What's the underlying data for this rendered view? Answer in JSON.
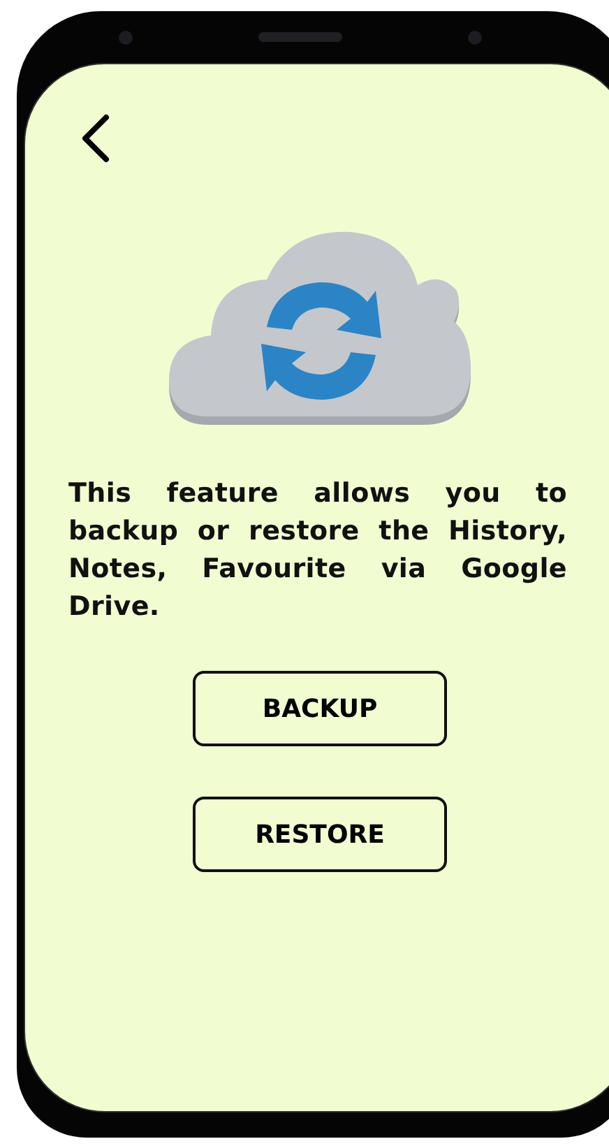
{
  "screen": {
    "description": "This feature allows you to backup or restore the History, Notes, Favourite via Google Drive.",
    "buttons": [
      {
        "label": "BACKUP"
      },
      {
        "label": "RESTORE"
      }
    ]
  }
}
